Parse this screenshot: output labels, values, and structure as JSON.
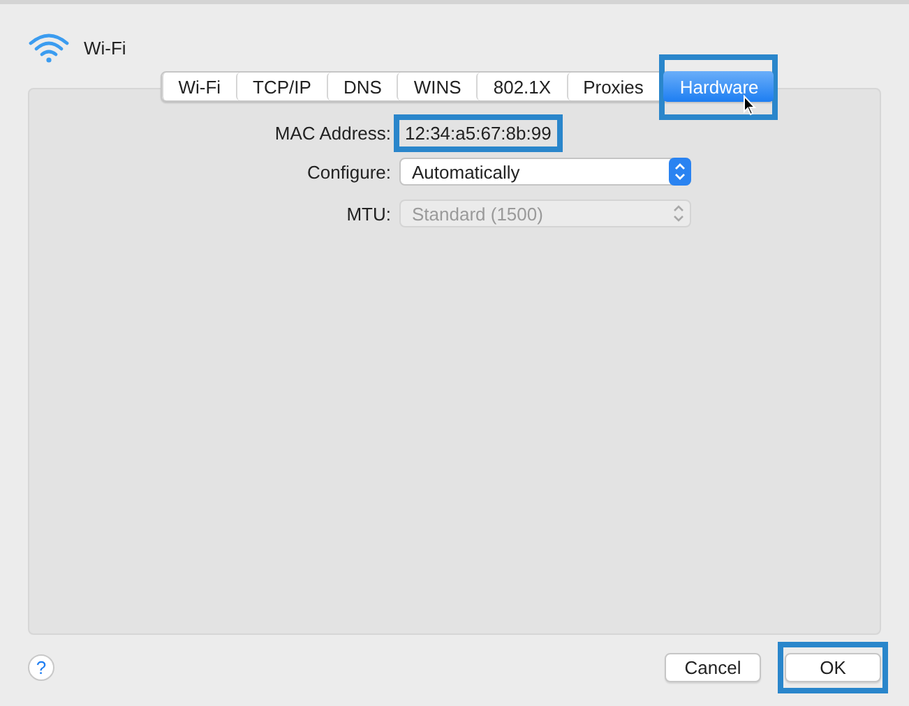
{
  "window": {
    "title": "Wi-Fi"
  },
  "tabs": [
    {
      "label": "Wi-Fi",
      "selected": false,
      "highlighted": false
    },
    {
      "label": "TCP/IP",
      "selected": false,
      "highlighted": false
    },
    {
      "label": "DNS",
      "selected": false,
      "highlighted": false
    },
    {
      "label": "WINS",
      "selected": false,
      "highlighted": false
    },
    {
      "label": "802.1X",
      "selected": false,
      "highlighted": false
    },
    {
      "label": "Proxies",
      "selected": false,
      "highlighted": false
    },
    {
      "label": "Hardware",
      "selected": true,
      "highlighted": true
    }
  ],
  "fields": [
    {
      "kind": "text",
      "label": "MAC Address:",
      "value": "12:34:a5:67:8b:99",
      "highlighted": true
    },
    {
      "kind": "select",
      "label": "Configure:",
      "value": "Automatically",
      "disabled": false
    },
    {
      "kind": "select",
      "label": "MTU:",
      "value": "Standard  (1500)",
      "disabled": true
    }
  ],
  "help": {
    "label": "?"
  },
  "buttons": [
    {
      "label": "Cancel",
      "highlighted": false
    },
    {
      "label": "OK",
      "highlighted": true
    }
  ]
}
